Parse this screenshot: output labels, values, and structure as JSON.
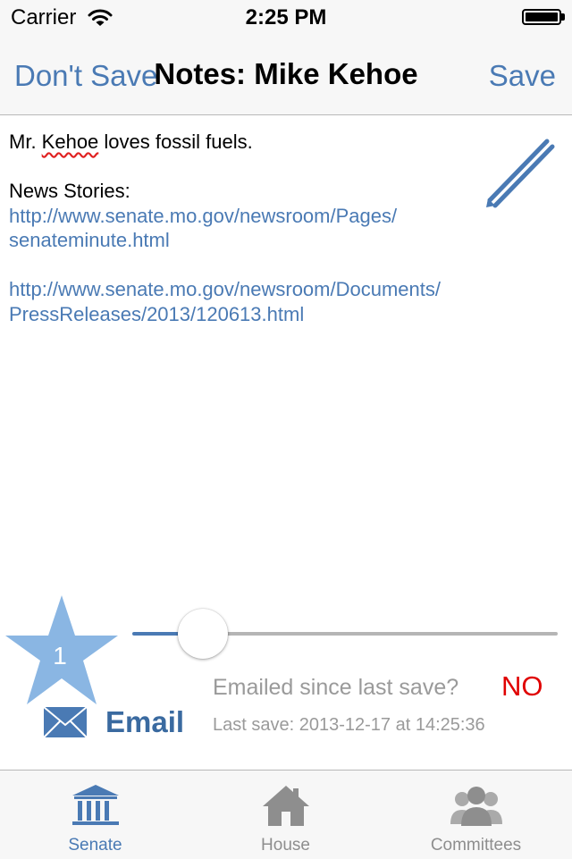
{
  "status_bar": {
    "carrier": "Carrier",
    "time": "2:25 PM"
  },
  "nav": {
    "left_button": "Don't Save",
    "title": "Notes: Mike Kehoe",
    "right_button": "Save"
  },
  "notes": {
    "first_line_prefix": "Mr. ",
    "first_line_misspelled": "Kehoe",
    "first_line_suffix": " loves fossil fuels.",
    "heading": "News Stories:",
    "links": [
      {
        "line1": "http://www.senate.mo.gov/newsroom/Pages/",
        "line2": "senateminute.html"
      },
      {
        "line1": "http://www.senate.mo.gov/newsroom/Documents/",
        "line2": "PressReleases/2013/120613.html"
      }
    ]
  },
  "rating": {
    "value": "1",
    "slider_fraction": 0.17
  },
  "status": {
    "emailed_label": "Emailed since last save?",
    "emailed_value": "NO",
    "last_save": "Last save: 2013-12-17 at 14:25:36"
  },
  "email_button": {
    "label": "Email"
  },
  "tabs": [
    {
      "label": "Senate",
      "icon": "capitol-icon",
      "active": true
    },
    {
      "label": "House",
      "icon": "house-icon",
      "active": false
    },
    {
      "label": "Committees",
      "icon": "people-icon",
      "active": false
    }
  ],
  "colors": {
    "accent": "#4a7ab4",
    "star": "#8ab6e3",
    "alert": "#e00000",
    "muted": "#9a9a9a"
  }
}
